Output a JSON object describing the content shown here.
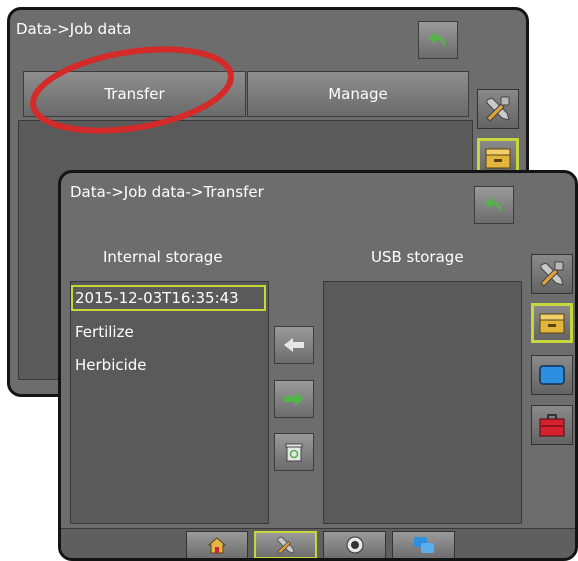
{
  "back_window": {
    "title": "Data->Job data",
    "transfer_label": "Transfer",
    "manage_label": "Manage"
  },
  "front_window": {
    "title": "Data->Job data->Transfer",
    "internal_label": "Internal storage",
    "usb_label": "USB storage",
    "internal_items": [
      "2015-12-03T16:35:43",
      "Fertilize",
      "Herbicide"
    ],
    "selected_index": 0
  },
  "colors": {
    "highlight": "#c7d63a",
    "annotation_circle": "#d42a2a",
    "back_arrow": "#55b447",
    "transfer_right_arrow": "#55b447",
    "storage_icon": "#e2b53c",
    "display_icon": "#2e8fe0",
    "toolbox_icon": "#d42230"
  },
  "icons": {
    "back": "back-arrow-icon",
    "tools": "tools-icon",
    "storage": "storage-drawer-icon",
    "display": "display-icon",
    "toolbox": "toolbox-icon",
    "home": "home-icon",
    "camera": "camera-icon",
    "share": "share-icon"
  }
}
